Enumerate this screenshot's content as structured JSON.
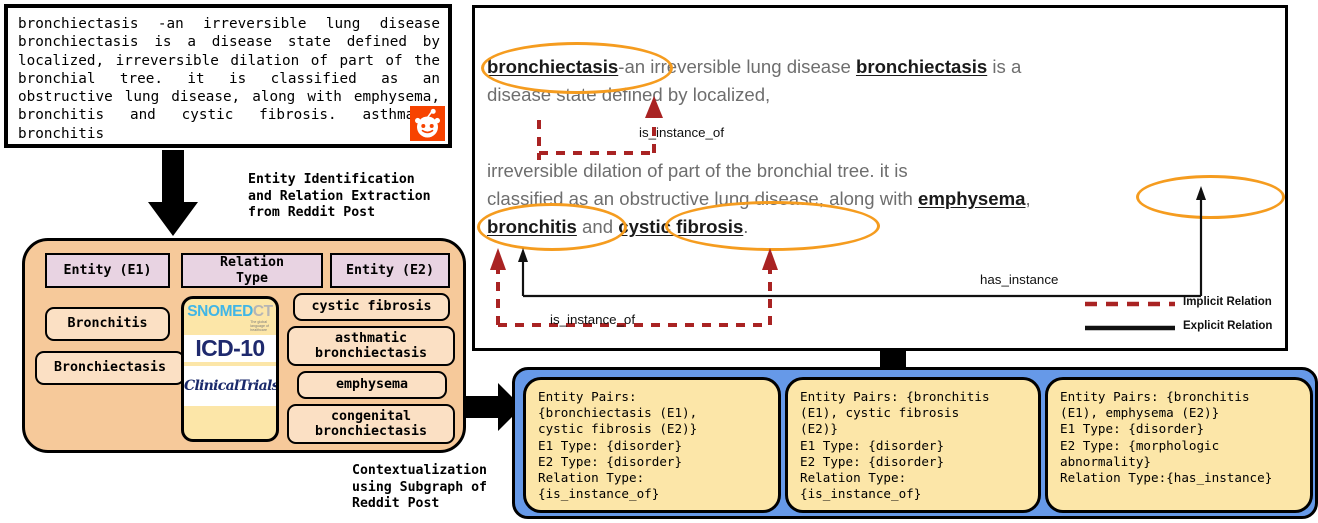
{
  "reddit_post": {
    "text": "bronchiectasis -an irreversible lung disease bronchiectasis is a disease state defined by localized, irreversible dilation of part of the bronchial tree. it is classified as an obstructive lung disease, along with emphysema, bronchitis and cystic fibrosis. asthmatic bronchitis",
    "source_icon": "reddit-icon"
  },
  "captions": {
    "extraction": "Entity Identification\nand Relation Extraction\nfrom Reddit Post",
    "contextualization": "Contextualization\nusing Subgraph of\nReddit Post"
  },
  "kg_table": {
    "headers": [
      "Entity (E1)",
      "Relation\nType",
      "Entity (E2)"
    ],
    "e1_values": [
      "Bronchitis",
      "Bronchiectasis"
    ],
    "ontologies": {
      "snomed_main": "SNOMED",
      "snomed_suffix": "CT",
      "snomed_tagline": "The global\nlanguage of\nhealthcare",
      "icd": "ICD-10",
      "clinicaltrials": "ClinicalTrials.gov"
    },
    "e2_values": [
      "cystic fibrosis",
      "asthmatic\nbronchiectasis",
      "emphysema",
      "congenital\nbronchiectasis"
    ]
  },
  "annotated_text": {
    "line1_pre": "",
    "entity_bronchiectasis_1": "bronchiectasis",
    "line1_mid": "-an irreversible lung disease ",
    "entity_bronchiectasis_2": "bronchiectasis",
    "line1_post": " is a",
    "line2": "disease state defined by localized,",
    "line3": "irreversible dilation of part of the bronchial tree. it is",
    "line4_pre": "classified as an obstructive lung disease, along with ",
    "entity_emphysema": "emphysema",
    "line4_post": ",",
    "entity_bronchitis": "bronchitis",
    "line5_mid": " and ",
    "entity_cystic_fibrosis": "cystic fibrosis",
    "line5_post": "."
  },
  "relations": {
    "is_instance_of_top": "is_instance_of",
    "is_instance_of_bottom": "is_instance_of",
    "has_instance": "has_instance"
  },
  "legend": {
    "implicit": "Implicit Relation",
    "explicit": "Explicit Relation",
    "implicit_color": "#a92323",
    "explicit_color": "#111111"
  },
  "cards": [
    {
      "entity_pairs_label": "Entity Pairs:",
      "entity_pairs_value": "{bronchiectasis (E1), cystic fibrosis (E2)}",
      "e1_type_label": "E1 Type:",
      "e1_type_value": "{disorder}",
      "e2_type_label": "E2 Type:",
      "e2_type_value": "{disorder}",
      "relation_type_label": "Relation Type:",
      "relation_type_value": "{is_instance_of}",
      "text": "Entity Pairs:\n{bronchiectasis (E1),\ncystic fibrosis (E2)}\nE1 Type: {disorder}\nE2 Type: {disorder}\nRelation Type:\n{is_instance_of}"
    },
    {
      "entity_pairs_label": "Entity Pairs:",
      "entity_pairs_value": "{bronchitis (E1), cystic fibrosis (E2)}",
      "e1_type_label": "E1 Type:",
      "e1_type_value": "{disorder}",
      "e2_type_label": "E2 Type:",
      "e2_type_value": "{disorder}",
      "relation_type_label": "Relation Type:",
      "relation_type_value": "{is_instance_of}",
      "text": "Entity Pairs: {bronchitis\n(E1), cystic fibrosis\n(E2)}\nE1 Type: {disorder}\nE2 Type: {disorder}\nRelation Type:\n{is_instance_of}"
    },
    {
      "entity_pairs_label": "Entity  Pairs:",
      "entity_pairs_value": "{bronchitis (E1), emphysema (E2)}",
      "e1_type_label": "E1 Type:",
      "e1_type_value": "{disorder}",
      "e2_type_label": "E2 Type:",
      "e2_type_value": "{morphologic abnormality}",
      "relation_type_label": "Relation Type:",
      "relation_type_value": "{has_instance}",
      "text": "Entity  Pairs: {bronchitis\n(E1), emphysema (E2)}\nE1 Type: {disorder}\nE2 Type: {morphologic\nabnormality}\nRelation Type:{has_instance}"
    }
  ],
  "colors": {
    "highlight_oval": "#f59c1f",
    "panel_peach": "#f6c99a",
    "card_yellow": "#fce6a8",
    "strip_blue": "#6699e8",
    "header_lilac": "#e8d3e2",
    "reddit_orange": "#f74300"
  }
}
